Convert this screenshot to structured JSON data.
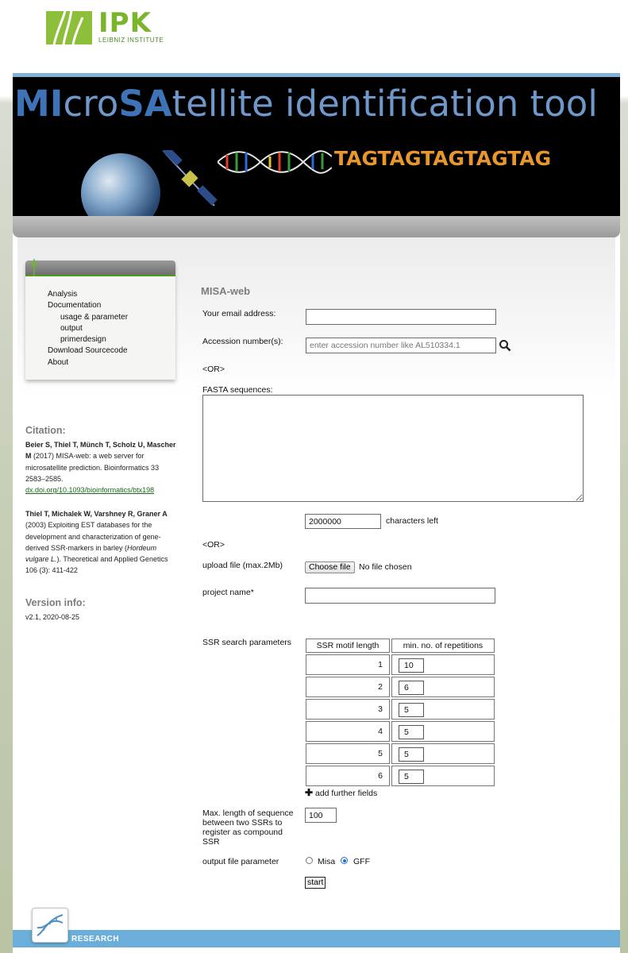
{
  "header": {
    "logo_text": "IPK",
    "logo_sub": "LEIBNIZ INSTITUTE",
    "banner_title_parts": [
      "MI",
      "cro",
      "SA",
      "tellite identification tool"
    ],
    "banner_sequence": "TAGTAGTAGTAGTAG"
  },
  "sidebar": {
    "nav": [
      {
        "label": "Analysis",
        "level": 0
      },
      {
        "label": "Documentation",
        "level": 0
      },
      {
        "label": "usage & parameter",
        "level": 1
      },
      {
        "label": "output",
        "level": 1
      },
      {
        "label": "primerdesign",
        "level": 1
      },
      {
        "label": "Download Sourcecode",
        "level": 0
      },
      {
        "label": "About",
        "level": 0
      }
    ],
    "citation_heading": "Citation:",
    "citation1": {
      "authors": "Beier S, Thiel T, Münch T, Scholz U, Mascher M",
      "text": " (2017) MISA-web: a web server for microsatellite prediction. Bioinformatics 33 2583–2585.",
      "link": "dx.doi.org/10.1093/bioinformatics/btx198"
    },
    "citation2": {
      "authors": "Thiel T, Michalek W, Varshney R, Graner A",
      "text_before": " (2003) Exploiting EST databases for the development and characterization of gene-derived SSR-markers in barley (",
      "italic": "Hordeum vulgare L.",
      "text_after": "). Theoretical and Applied Genetics 106 (3): 411-422"
    },
    "version_heading": "Version info:",
    "version_text": "v2.1, 2020-08-25"
  },
  "form": {
    "title": "MISA-web",
    "email_label": "Your email address:",
    "email_value": "",
    "accession_label": "Accession number(s):",
    "accession_placeholder": "enter accession number like AL510334.1",
    "or1": "<OR>",
    "fasta_label": "FASTA sequences:",
    "chars_value": "2000000",
    "chars_label": "characters left",
    "or2": "<OR>",
    "upload_label": "upload file (max.2Mb)",
    "choose_file_label": "Choose file",
    "no_file_text": "No file chosen",
    "project_label": "project name*",
    "project_value": "",
    "ssr_label": "SSR search parameters",
    "ssr_col1": "SSR motif length",
    "ssr_col2": "min. no. of repetitions",
    "ssr_rows": [
      {
        "motif": "1",
        "reps": "10"
      },
      {
        "motif": "2",
        "reps": "6"
      },
      {
        "motif": "3",
        "reps": "5"
      },
      {
        "motif": "4",
        "reps": "5"
      },
      {
        "motif": "5",
        "reps": "5"
      },
      {
        "motif": "6",
        "reps": "5"
      }
    ],
    "add_fields_label": "add further fields",
    "maxlen_label": "Max. length of sequence between two SSRs to register as compound SSR",
    "maxlen_value": "100",
    "output_label": "output file parameter",
    "output_options": [
      {
        "label": "Misa",
        "selected": false
      },
      {
        "label": "GFF",
        "selected": true
      }
    ],
    "start_label": "start"
  },
  "footer": {
    "research_label": "RESEARCH"
  },
  "colors": {
    "ipk_green": "#7ab52c",
    "banner_blue": "#3f73b8",
    "sequence_orange": "#e8962e",
    "footer_blue": "#6aaed9"
  }
}
